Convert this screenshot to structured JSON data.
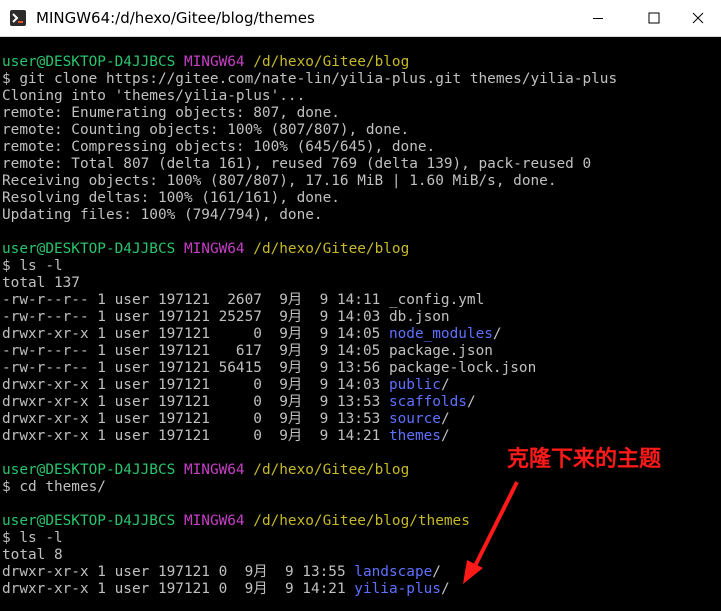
{
  "window": {
    "title": "MINGW64:/d/hexo/Gitee/blog/themes",
    "icon": "git-bash-icon",
    "controls": [
      "minimize-icon",
      "maximize-icon",
      "close-icon"
    ]
  },
  "colors": {
    "user": "#29c46d",
    "mingw": "#c63fc6",
    "path": "#c5b928",
    "directory": "#5f70ff",
    "text": "#c0c0c0",
    "annotation": "#ff1a1a"
  },
  "terminal": {
    "blocks": [
      {
        "prompt": {
          "user": "user@DESKTOP-D4JJBCS",
          "env": "MINGW64",
          "path": "/d/hexo/Gitee/blog"
        },
        "command": "$ git clone https://gitee.com/nate-lin/yilia-plus.git themes/yilia-plus",
        "output": [
          "Cloning into 'themes/yilia-plus'...",
          "remote: Enumerating objects: 807, done.",
          "remote: Counting objects: 100% (807/807), done.",
          "remote: Compressing objects: 100% (645/645), done.",
          "remote: Total 807 (delta 161), reused 769 (delta 139), pack-reused 0",
          "Receiving objects: 100% (807/807), 17.16 MiB | 1.60 MiB/s, done.",
          "Resolving deltas: 100% (161/161), done.",
          "Updating files: 100% (794/794), done."
        ]
      },
      {
        "prompt": {
          "user": "user@DESKTOP-D4JJBCS",
          "env": "MINGW64",
          "path": "/d/hexo/Gitee/blog"
        },
        "command": "$ ls -l",
        "total": "total 137",
        "listing": [
          {
            "meta": "-rw-r--r-- 1 user 197121  2607  9月  9 14:11 ",
            "name": "_config.yml",
            "is_dir": false
          },
          {
            "meta": "-rw-r--r-- 1 user 197121 25257  9月  9 14:03 ",
            "name": "db.json",
            "is_dir": false
          },
          {
            "meta": "drwxr-xr-x 1 user 197121     0  9月  9 14:05 ",
            "name": "node_modules",
            "is_dir": true
          },
          {
            "meta": "-rw-r--r-- 1 user 197121   617  9月  9 14:05 ",
            "name": "package.json",
            "is_dir": false
          },
          {
            "meta": "-rw-r--r-- 1 user 197121 56415  9月  9 13:56 ",
            "name": "package-lock.json",
            "is_dir": false
          },
          {
            "meta": "drwxr-xr-x 1 user 197121     0  9月  9 14:03 ",
            "name": "public",
            "is_dir": true
          },
          {
            "meta": "drwxr-xr-x 1 user 197121     0  9月  9 13:53 ",
            "name": "scaffolds",
            "is_dir": true
          },
          {
            "meta": "drwxr-xr-x 1 user 197121     0  9月  9 13:53 ",
            "name": "source",
            "is_dir": true
          },
          {
            "meta": "drwxr-xr-x 1 user 197121     0  9月  9 14:21 ",
            "name": "themes",
            "is_dir": true
          }
        ]
      },
      {
        "prompt": {
          "user": "user@DESKTOP-D4JJBCS",
          "env": "MINGW64",
          "path": "/d/hexo/Gitee/blog"
        },
        "command": "$ cd themes/"
      },
      {
        "prompt": {
          "user": "user@DESKTOP-D4JJBCS",
          "env": "MINGW64",
          "path": "/d/hexo/Gitee/blog/themes"
        },
        "command": "$ ls -l",
        "total": "total 8",
        "listing": [
          {
            "meta": "drwxr-xr-x 1 user 197121 0  9月  9 13:55 ",
            "name": "landscape",
            "is_dir": true
          },
          {
            "meta": "drwxr-xr-x 1 user 197121 0  9月  9 14:21 ",
            "name": "yilia-plus",
            "is_dir": true
          }
        ]
      }
    ]
  },
  "annotation": {
    "text": "克隆下来的主题",
    "arrow_icon": "red-arrow-icon"
  }
}
